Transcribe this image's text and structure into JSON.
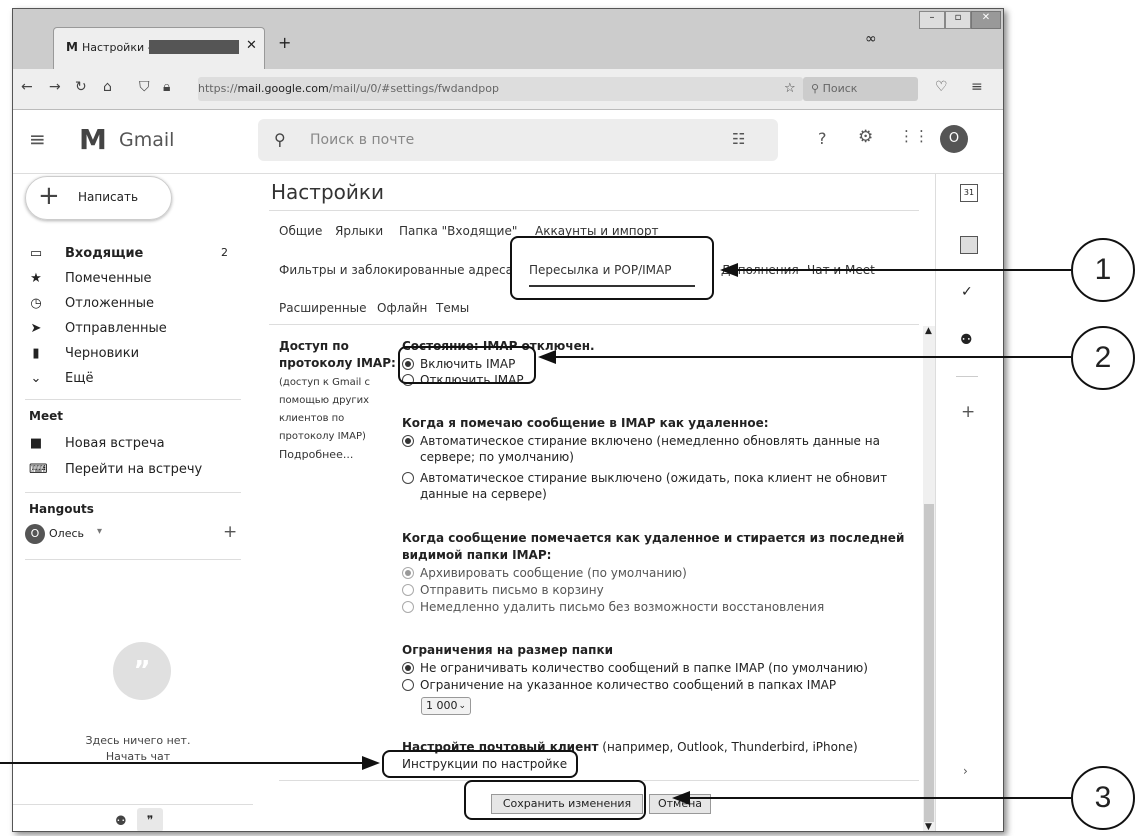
{
  "browser": {
    "tab_title": "Настройки - ",
    "new_tab": "+",
    "url_prefix": "https://",
    "url_domain": "mail.google.com",
    "url_path": "/mail/u/0/#settings/fwdandpop",
    "search_placeholder": "Поиск"
  },
  "gmail": {
    "app_name": "Gmail",
    "search_placeholder": "Поиск в почте",
    "avatar_letter": "O"
  },
  "sidebar": {
    "compose": "Написать",
    "items": [
      {
        "label": "Входящие",
        "count": "2",
        "icon": "inbox-icon"
      },
      {
        "label": "Помеченные",
        "icon": "star-icon"
      },
      {
        "label": "Отложенные",
        "icon": "clock-icon"
      },
      {
        "label": "Отправленные",
        "icon": "send-icon"
      },
      {
        "label": "Черновики",
        "icon": "draft-icon"
      },
      {
        "label": "Ещё",
        "icon": "chevron-down-icon"
      }
    ],
    "meet_title": "Meet",
    "meet_items": [
      {
        "label": "Новая встреча",
        "icon": "video-icon"
      },
      {
        "label": "Перейти на встречу",
        "icon": "keyboard-icon"
      }
    ],
    "hangouts_title": "Hangouts",
    "hangouts_user": "Олесь",
    "hangouts_user_initial": "О",
    "empty_line1": "Здесь ничего нет.",
    "empty_line2": "Начать чат"
  },
  "settings": {
    "title": "Настройки",
    "tabs_row1": [
      "Общие",
      "Ярлыки",
      "Папка \"Входящие\"",
      "Аккаунты и импорт"
    ],
    "tabs_row2": [
      "Фильтры и заблокированные адреса",
      "Пересылка и POP/IMAP",
      "Дополнения",
      "Чат и Meet"
    ],
    "tabs_row3": [
      "Расширенные",
      "Офлайн",
      "Темы"
    ],
    "imap_label_bold1": "Доступ по",
    "imap_label_bold2": "протоколу IMAP:",
    "imap_label_sub": [
      "(доступ к Gmail с",
      "помощью других",
      "клиентов по",
      "протоколу IMAP)"
    ],
    "imap_more": "Подробнее...",
    "status": "Состояние: IMAP отключен.",
    "enable_imap": "Включить IMAP",
    "disable_imap": "Отключить IMAP",
    "deleted_title": "Когда я помечаю сообщение в IMAP как удаленное:",
    "auto_on_1": "Автоматическое стирание включено (немедленно обновлять данные на",
    "auto_on_2": "сервере; по умолчанию)",
    "auto_off_1": "Автоматическое стирание выключено (ожидать, пока клиент не обновит",
    "auto_off_2": "данные на сервере)",
    "expunge_title_1": "Когда сообщение помечается как удаленное и стирается из последней",
    "expunge_title_2": "видимой папки IMAP:",
    "archive": "Архивировать сообщение (по умолчанию)",
    "trash": "Отправить письмо в корзину",
    "delete_forever": "Немедленно удалить письмо без возможности восстановления",
    "folder_limit_title": "Ограничения на размер папки",
    "no_limit": "Не ограничивать количество сообщений в папке IMAP (по умолчанию)",
    "limit": "Ограничение на указанное количество сообщений в папках IMAP",
    "limit_value": "1 000",
    "client_bold": "Настройте почтовый клиент",
    "client_rest": " (например, Outlook, Thunderbird, iPhone)",
    "instructions": "Инструкции по настройке",
    "save": "Сохранить изменения",
    "cancel": "Отмена"
  },
  "callouts": [
    "1",
    "2",
    "3"
  ]
}
